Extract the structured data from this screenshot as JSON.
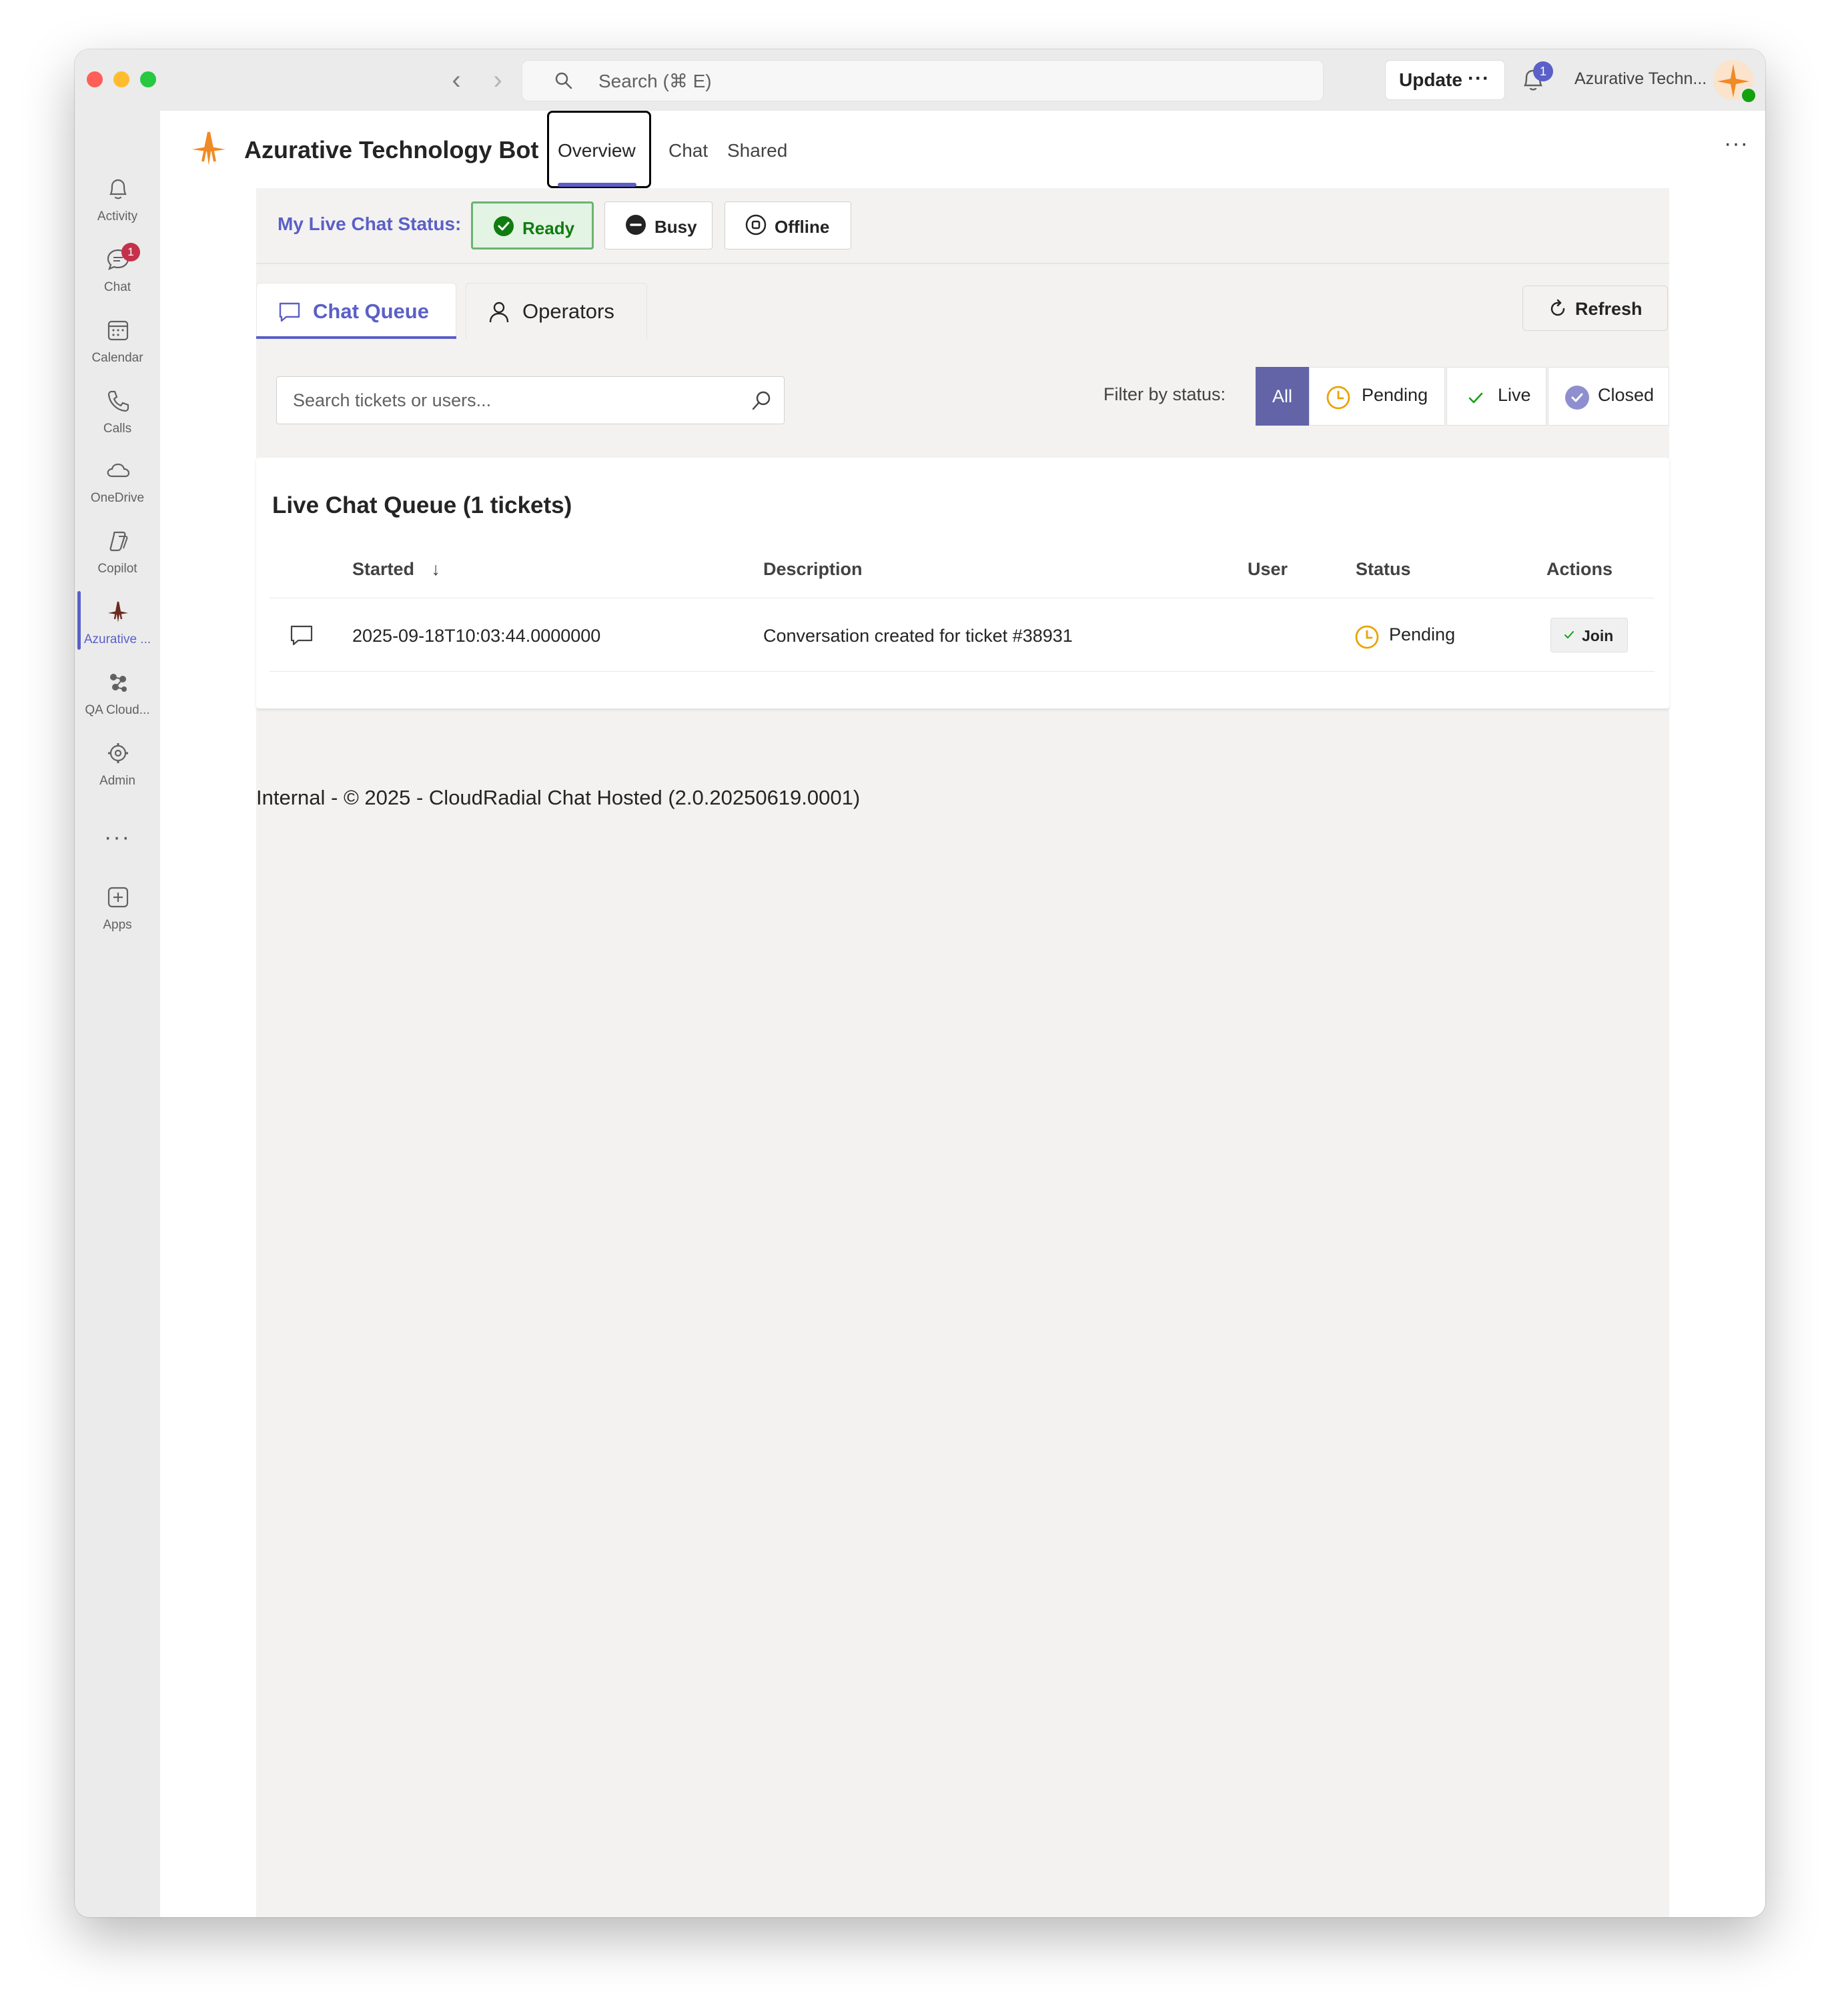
{
  "titlebar": {
    "search_placeholder": "Search (⌘ E)",
    "update_label": "Update",
    "update_more": "···",
    "notification_count": "1",
    "org_name": "Azurative Techn..."
  },
  "rail": {
    "items": [
      {
        "label": "Activity",
        "icon": "bell-icon"
      },
      {
        "label": "Chat",
        "icon": "chat-icon",
        "badge": "1"
      },
      {
        "label": "Calendar",
        "icon": "calendar-icon"
      },
      {
        "label": "Calls",
        "icon": "phone-icon"
      },
      {
        "label": "OneDrive",
        "icon": "cloud-icon"
      },
      {
        "label": "Copilot",
        "icon": "copilot-icon"
      },
      {
        "label": "Azurative ...",
        "icon": "azurative-logo-icon",
        "active": true
      },
      {
        "label": "QA Cloud...",
        "icon": "qa-cloud-icon"
      },
      {
        "label": "Admin",
        "icon": "admin-icon"
      },
      {
        "label": "Apps",
        "icon": "apps-plus-icon"
      }
    ],
    "more": "···"
  },
  "app": {
    "title": "Azurative Technology Bot",
    "tabs": [
      "Overview",
      "Chat",
      "Shared"
    ],
    "active_tab": "Overview",
    "more": "···"
  },
  "status": {
    "label": "My Live Chat Status:",
    "options": [
      "Ready",
      "Busy",
      "Offline"
    ],
    "selected": "Ready"
  },
  "queue_tabs": {
    "chat_queue": "Chat Queue",
    "operators": "Operators",
    "active": "Chat Queue"
  },
  "refresh_label": "Refresh",
  "ticket_search": {
    "placeholder": "Search tickets or users..."
  },
  "filter": {
    "label": "Filter by status:",
    "options": [
      "All",
      "Pending",
      "Live",
      "Closed"
    ],
    "selected": "All"
  },
  "queue": {
    "title": "Live Chat Queue (1 tickets)",
    "columns": [
      "Started",
      "Description",
      "User",
      "Status",
      "Actions"
    ],
    "sort_indicator": "↓",
    "rows": [
      {
        "started": "2025-09-18T10:03:44.0000000",
        "description": "Conversation created for ticket #38931",
        "user": "",
        "status": "Pending",
        "action": "Join"
      }
    ]
  },
  "footer": "Internal - © 2025 - CloudRadial Chat Hosted (2.0.20250619.0001)",
  "colors": {
    "accent": "#5b5fc7",
    "filter_selected": "#6264a7",
    "ready_green": "#107c10",
    "pending_yellow": "#eaa300",
    "closed_purple": "#8f8fcf",
    "brand_orange": "#f08a24"
  }
}
